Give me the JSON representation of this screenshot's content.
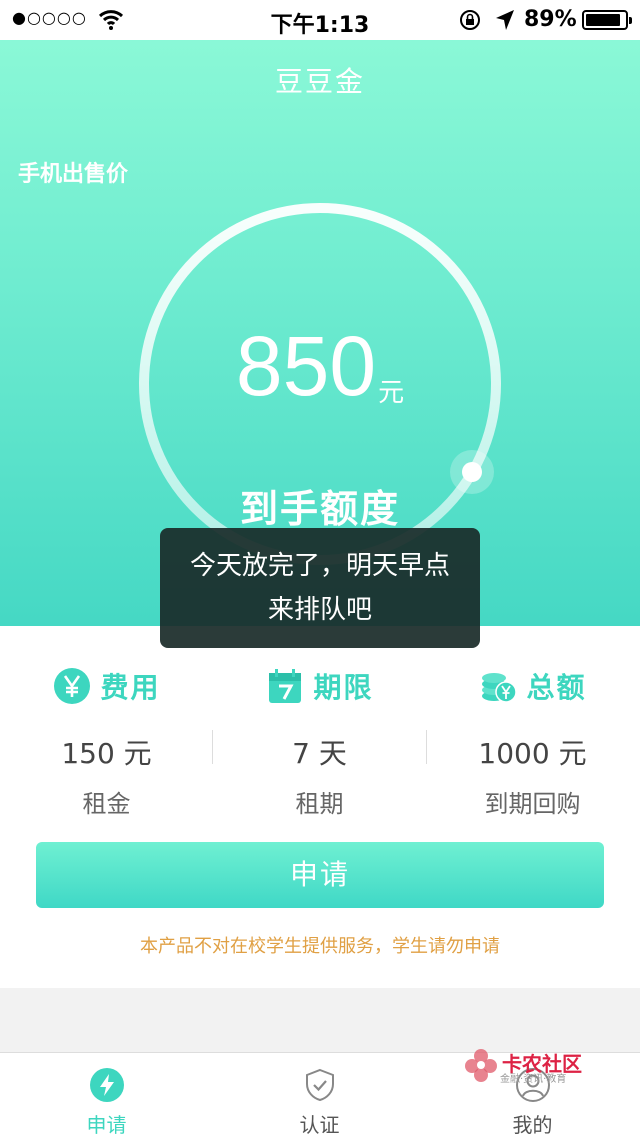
{
  "status": {
    "time": "下午1:13",
    "battery": "89%",
    "battery_level": 0.89
  },
  "header": {
    "title": "豆豆金"
  },
  "hero": {
    "sale_label": "手机出售价",
    "amount": "850",
    "unit": "元",
    "amount_label": "到手额度"
  },
  "toast": {
    "line1": "今天放完了，明天早点",
    "line2": "来排队吧"
  },
  "stats": [
    {
      "title": "费用",
      "value": "150 元",
      "sub": "租金",
      "icon": "yen-icon"
    },
    {
      "title": "期限",
      "value": "7 天",
      "sub": "租期",
      "icon": "calendar-icon"
    },
    {
      "title": "总额",
      "value": "1000 元",
      "sub": "到期回购",
      "icon": "coins-icon"
    }
  ],
  "apply": {
    "label": "申请"
  },
  "notice": "本产品不对在校学生提供服务，学生请勿申请",
  "tabbar": [
    {
      "label": "申请",
      "icon": "lightning-icon",
      "active": true
    },
    {
      "label": "认证",
      "icon": "shield-check-icon",
      "active": false
    },
    {
      "label": "我的",
      "icon": "user-icon",
      "active": false
    }
  ],
  "watermark": {
    "title": "卡农社区",
    "sub": "金融·资讯·教育"
  },
  "colors": {
    "accent": "#3dd6bf",
    "notice": "#e0a044",
    "toast_bg": "#192a28"
  }
}
